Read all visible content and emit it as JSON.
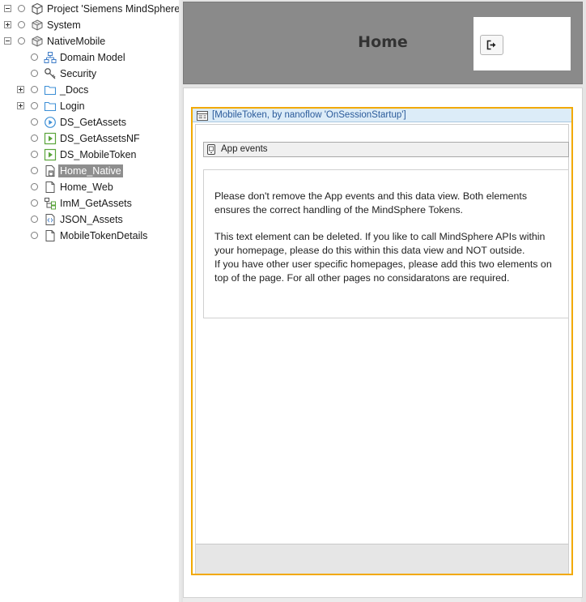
{
  "tree": {
    "items": [
      {
        "label": "Project 'Siemens MindSphere N",
        "icon": "project-icon"
      },
      {
        "label": "System",
        "icon": "module-icon"
      },
      {
        "label": "NativeMobile",
        "icon": "module-icon"
      },
      {
        "label": "Domain Model",
        "icon": "domain-model-icon"
      },
      {
        "label": "Security",
        "icon": "security-key-icon"
      },
      {
        "label": "_Docs",
        "icon": "folder-icon"
      },
      {
        "label": "Login",
        "icon": "folder-icon"
      },
      {
        "label": "DS_GetAssets",
        "icon": "nanoflow-icon"
      },
      {
        "label": "DS_GetAssetsNF",
        "icon": "microflow-icon"
      },
      {
        "label": "DS_MobileToken",
        "icon": "microflow-icon"
      },
      {
        "label": "Home_Native",
        "icon": "native-page-icon",
        "selected": true
      },
      {
        "label": "Home_Web",
        "icon": "page-icon"
      },
      {
        "label": "ImM_GetAssets",
        "icon": "import-mapping-icon"
      },
      {
        "label": "JSON_Assets",
        "icon": "json-structure-icon"
      },
      {
        "label": "MobileTokenDetails",
        "icon": "page-icon"
      }
    ]
  },
  "editor": {
    "page_title": "Home",
    "header_button_icon": "logout-icon",
    "dataview": {
      "title": "[MobileToken, by nanoflow 'OnSessionStartup']",
      "icon": "dataview-icon",
      "app_events": {
        "label": "App events",
        "icon": "app-events-icon"
      },
      "text": {
        "line1": "Please don't remove the App events and this data view. Both elements ensures the correct handling of the MindSphere Tokens.",
        "line2": "This text element can be deleted. If you like to call MindSphere APIs within your homepage, please do this within this data view and NOT outside.",
        "line3": "If you have other user specific homepages, please add this two elements on top of the page. For all other pages no considaratons are required."
      }
    },
    "colors": {
      "selection_border": "#f2a900",
      "dataview_header": "#dcecf8",
      "dataview_title": "#2a5a9a",
      "header_background": "#8a8a8a"
    }
  }
}
